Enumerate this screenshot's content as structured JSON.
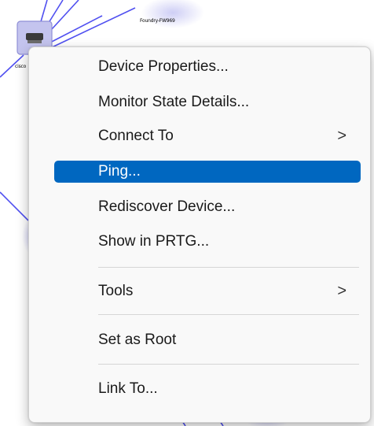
{
  "nodes": {
    "top_device_label": "Foundry-FW969",
    "left_device_label": "cisco"
  },
  "menu": {
    "items": [
      {
        "label": "Device Properties...",
        "submenu": false
      },
      {
        "label": "Monitor State Details...",
        "submenu": false
      },
      {
        "label": "Connect To",
        "submenu": true
      },
      {
        "label": "Ping...",
        "submenu": false,
        "highlighted": true
      },
      {
        "label": "Rediscover Device...",
        "submenu": false
      },
      {
        "label": "Show in PRTG...",
        "submenu": false
      },
      {
        "label": "Tools",
        "submenu": true
      },
      {
        "label": "Set as Root",
        "submenu": false
      },
      {
        "label": "Link To...",
        "submenu": false
      }
    ],
    "submenu_glyph": ">"
  },
  "colors": {
    "highlight": "#0067c0",
    "link_line": "#5050f0",
    "menu_bg": "#f9f9f9"
  }
}
